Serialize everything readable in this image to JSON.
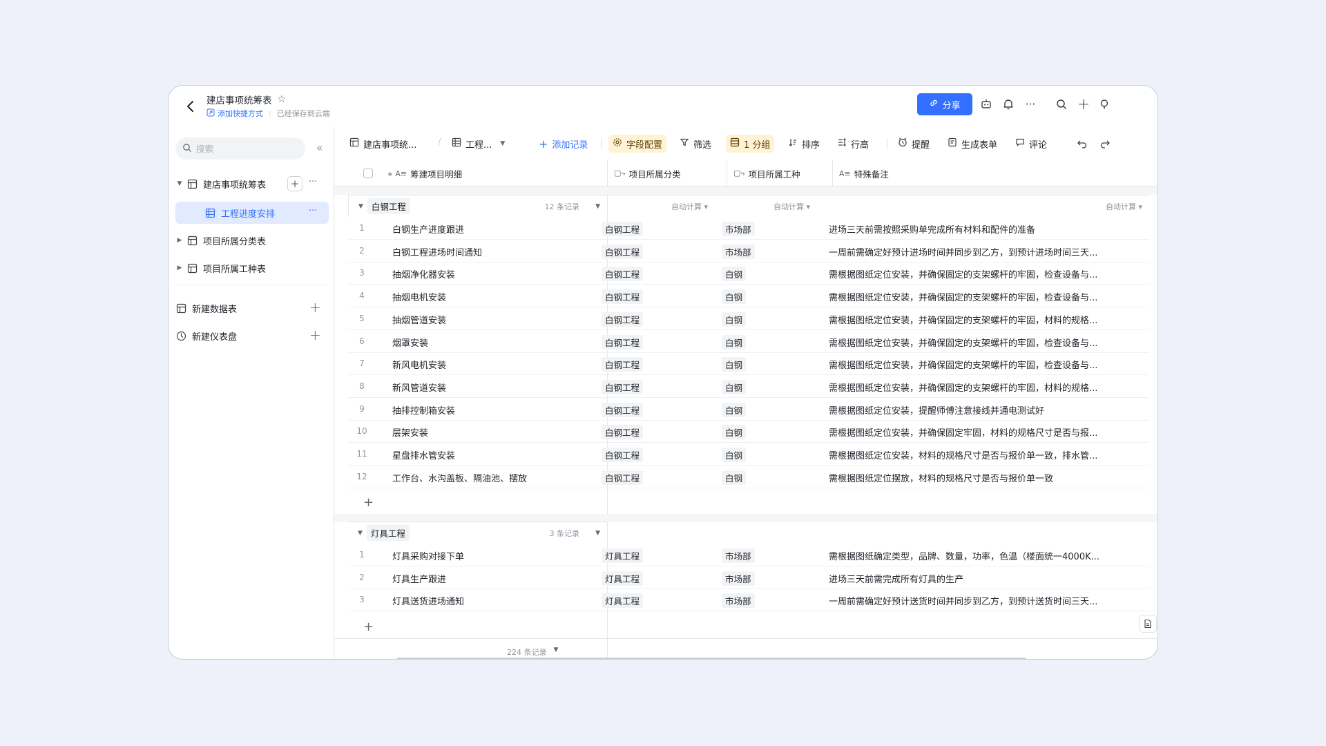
{
  "header": {
    "title": "建店事项统筹表",
    "add_shortcut": "添加快捷方式",
    "saved": "已经保存到云端",
    "share_label": "分享"
  },
  "sidebar": {
    "search_placeholder": "搜索",
    "tree": [
      {
        "label": "建店事项统筹表"
      },
      {
        "label": "工程进度安排"
      },
      {
        "label": "项目所属分类表"
      },
      {
        "label": "项目所属工种表"
      }
    ],
    "new_table": "新建数据表",
    "new_dashboard": "新建仪表盘"
  },
  "toolbar": {
    "breadcrumb_table": "建店事项统...",
    "breadcrumb_view": "工程...",
    "add_record": "添加记录",
    "field_config": "字段配置",
    "filter": "筛选",
    "group": "1 分组",
    "sort": "排序",
    "row_height": "行高",
    "remind": "提醒",
    "form": "生成表单",
    "comment": "评论"
  },
  "columns": {
    "c1": "筹建项目明细",
    "c2": "项目所属分类",
    "c3": "项目所属工种",
    "c4": "特殊备注",
    "c5": "A"
  },
  "auto_calc": "自动计算",
  "groups": [
    {
      "name": "白钢工程",
      "count": "12 条记录",
      "rows": [
        {
          "n": "1",
          "name": "白钢生产进度跟进",
          "cat": "白钢工程",
          "type": "市场部",
          "note": "进场三天前需按照采购单完成所有材料和配件的准备"
        },
        {
          "n": "2",
          "name": "白钢工程进场时间通知",
          "cat": "白钢工程",
          "type": "市场部",
          "note": "一周前需确定好预计进场时间并同步到乙方，到预计进场时间三天..."
        },
        {
          "n": "3",
          "name": "抽烟净化器安装",
          "cat": "白钢工程",
          "type": "白钢",
          "note": "需根据图纸定位安装，并确保固定的支架螺杆的牢固，检查设备与..."
        },
        {
          "n": "4",
          "name": "抽烟电机安装",
          "cat": "白钢工程",
          "type": "白钢",
          "note": "需根据图纸定位安装，并确保固定的支架螺杆的牢固，检查设备与..."
        },
        {
          "n": "5",
          "name": "抽烟管道安装",
          "cat": "白钢工程",
          "type": "白钢",
          "note": "需根据图纸定位安装，并确保固定的支架螺杆的牢固，材料的规格..."
        },
        {
          "n": "6",
          "name": "烟罩安装",
          "cat": "白钢工程",
          "type": "白钢",
          "note": "需根据图纸定位安装，并确保固定的支架螺杆的牢固，检查设备与..."
        },
        {
          "n": "7",
          "name": "新风电机安装",
          "cat": "白钢工程",
          "type": "白钢",
          "note": "需根据图纸定位安装，并确保固定的支架螺杆的牢固，检查设备与..."
        },
        {
          "n": "8",
          "name": "新风管道安装",
          "cat": "白钢工程",
          "type": "白钢",
          "note": "需根据图纸定位安装，并确保固定的支架螺杆的牢固，材料的规格..."
        },
        {
          "n": "9",
          "name": "抽排控制箱安装",
          "cat": "白钢工程",
          "type": "白钢",
          "note": "需根据图纸定位安装，提醒师傅注意接线并通电测试好"
        },
        {
          "n": "10",
          "name": "层架安装",
          "cat": "白钢工程",
          "type": "白钢",
          "note": "需根据图纸定位安装，并确保固定牢固，材料的规格尺寸是否与报..."
        },
        {
          "n": "11",
          "name": "星盘排水管安装",
          "cat": "白钢工程",
          "type": "白钢",
          "note": "需根据图纸定位安装，材料的规格尺寸是否与报价单一致，排水管..."
        },
        {
          "n": "12",
          "name": "工作台、水沟盖板、隔油池、摆放",
          "cat": "白钢工程",
          "type": "白钢",
          "note": "需根据图纸定位摆放，材料的规格尺寸是否与报价单一致"
        }
      ]
    },
    {
      "name": "灯具工程",
      "count": "3 条记录",
      "rows": [
        {
          "n": "1",
          "name": "灯具采购对接下单",
          "cat": "灯具工程",
          "type": "市场部",
          "note": "需根据图纸确定类型，品牌、数量，功率，色温（楼面统一4000K..."
        },
        {
          "n": "2",
          "name": "灯具生产跟进",
          "cat": "灯具工程",
          "type": "市场部",
          "note": "进场三天前需完成所有灯具的生产"
        },
        {
          "n": "3",
          "name": "灯具送货进场通知",
          "cat": "灯具工程",
          "type": "市场部",
          "note": "一周前需确定好预计送货时间并同步到乙方，到预计送货时间三天..."
        }
      ]
    }
  ],
  "footer": {
    "total": "224 条记录"
  },
  "colors": {
    "accent": "#3370ff",
    "highlight": "#fff3d6",
    "background": "#eef1f9"
  }
}
